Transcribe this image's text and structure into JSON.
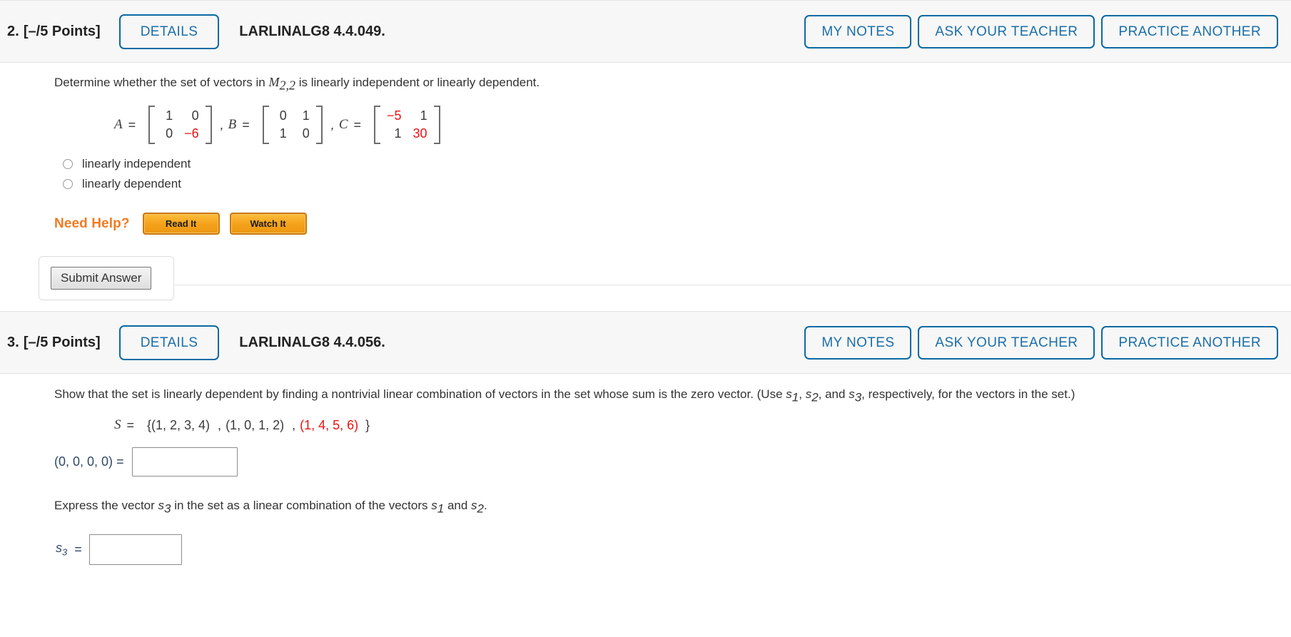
{
  "problems": [
    {
      "number": "2.",
      "points": "[–/5 Points]",
      "details_label": "DETAILS",
      "code": "LARLINALG8 4.4.049.",
      "header_buttons": [
        {
          "label": "MY NOTES",
          "name": "my-notes-button"
        },
        {
          "label": "ASK YOUR TEACHER",
          "name": "ask-your-teacher-button"
        },
        {
          "label": "PRACTICE ANOTHER",
          "name": "practice-another-button"
        }
      ],
      "prompt_before": "Determine whether the set of vectors in ",
      "prompt_var": "M",
      "prompt_var_sub": "2,2",
      "prompt_after": " is linearly independent or linearly dependent.",
      "matrices": [
        {
          "label": "A",
          "rows": [
            [
              {
                "v": "1",
                "red": false
              },
              {
                "v": "0",
                "red": false
              }
            ],
            [
              {
                "v": "0",
                "red": false
              },
              {
                "v": "−6",
                "red": true
              }
            ]
          ],
          "trailing": ","
        },
        {
          "label": "B",
          "rows": [
            [
              {
                "v": "0",
                "red": false
              },
              {
                "v": "1",
                "red": false
              }
            ],
            [
              {
                "v": "1",
                "red": false
              },
              {
                "v": "0",
                "red": false
              }
            ]
          ],
          "trailing": ","
        },
        {
          "label": "C",
          "rows": [
            [
              {
                "v": "−5",
                "red": true
              },
              {
                "v": "1",
                "red": false
              }
            ],
            [
              {
                "v": "1",
                "red": false
              },
              {
                "v": "30",
                "red": true
              }
            ]
          ],
          "trailing": ""
        }
      ],
      "choices": [
        {
          "label": "linearly independent",
          "selected": false
        },
        {
          "label": "linearly dependent",
          "selected": false
        }
      ],
      "need_help": {
        "label": "Need Help?",
        "buttons": [
          {
            "label": "Read It",
            "name": "read-it-button"
          },
          {
            "label": "Watch It",
            "name": "watch-it-button"
          }
        ]
      },
      "submit_label": "Submit Answer"
    },
    {
      "number": "3.",
      "points": "[–/5 Points]",
      "details_label": "DETAILS",
      "code": "LARLINALG8 4.4.056.",
      "header_buttons": [
        {
          "label": "MY NOTES",
          "name": "my-notes-button"
        },
        {
          "label": "ASK YOUR TEACHER",
          "name": "ask-your-teacher-button"
        },
        {
          "label": "PRACTICE ANOTHER",
          "name": "practice-another-button"
        }
      ],
      "prompt_part1": "Show that the set is linearly dependent by finding a nontrivial linear combination of vectors in the set whose sum is the zero vector. (Use ",
      "prompt_s1": "s",
      "prompt_s1_sub": "1",
      "prompt_mid1": ", ",
      "prompt_s2": "s",
      "prompt_s2_sub": "2",
      "prompt_mid2": ", and ",
      "prompt_s3": "s",
      "prompt_s3_sub": "3",
      "prompt_part2": ",  respectively, for the vectors in the set.)",
      "set_line": {
        "label": "S",
        "equals": "=",
        "open": "{",
        "vectors": [
          {
            "text": "(1, 2, 3, 4)",
            "red": false,
            "sep": ", "
          },
          {
            "text": "(1, 0, 1, 2)",
            "red": false,
            "sep": ", "
          },
          {
            "text": "(1, 4, 5, 6)",
            "red": true,
            "sep": ""
          }
        ],
        "close": "}"
      },
      "zero_answer": {
        "prefix": "(0, 0, 0, 0)  =",
        "value": "",
        "placeholder": ""
      },
      "express_part1": "Express the vector ",
      "express_s3": "s",
      "express_s3_sub": "3",
      "express_part2": " in the set as a linear combination of the vectors ",
      "express_s1": "s",
      "express_s1_sub": "1",
      "express_mid": " and ",
      "express_s2": "s",
      "express_s2_sub": "2",
      "express_end": ".",
      "s3_answer": {
        "label_base": "s",
        "label_sub": "3",
        "equals": "=",
        "value": "",
        "placeholder": ""
      }
    }
  ],
  "colors": {
    "accent_blue": "#0b6aa2",
    "link_blue": "#1b6ea8",
    "red_highlight": "#ee1111",
    "orange": "#f07b22",
    "header_bg": "#f7f7f7",
    "navy_text": "#2f4a66"
  }
}
